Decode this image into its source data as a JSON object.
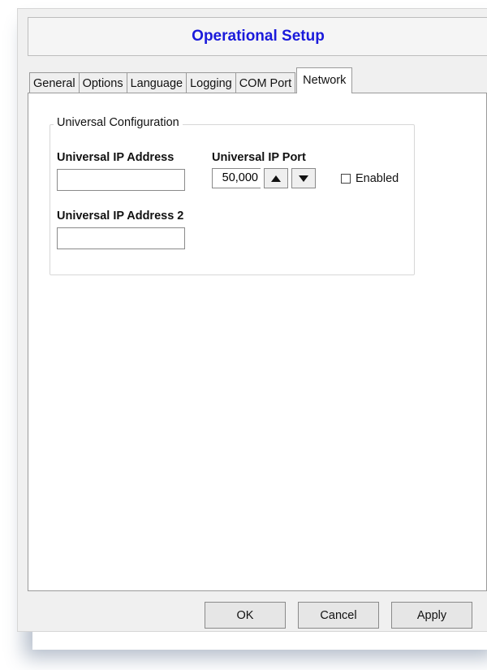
{
  "window": {
    "title": "Operational Setup"
  },
  "tabs": [
    {
      "label": "General"
    },
    {
      "label": "Options"
    },
    {
      "label": "Language"
    },
    {
      "label": "Logging"
    },
    {
      "label": "COM Port"
    },
    {
      "label": "Network",
      "active": true
    }
  ],
  "network": {
    "group_title": "Universal Configuration",
    "ip_address_label": "Universal IP Address",
    "ip_address_value": "",
    "ip_port_label": "Universal IP Port",
    "ip_port_value": "50,000",
    "enabled_label": "Enabled",
    "enabled_checked": false,
    "ip_address2_label": "Universal IP Address 2",
    "ip_address2_value": ""
  },
  "buttons": {
    "ok": "OK",
    "cancel": "Cancel",
    "apply": "Apply"
  },
  "icons": {
    "spin_up": "triangle-up-icon",
    "spin_down": "triangle-down-icon"
  },
  "colors": {
    "title": "#1a1adb",
    "dialog_bg": "#f0f0f0",
    "panel_bg": "#ffffff"
  }
}
